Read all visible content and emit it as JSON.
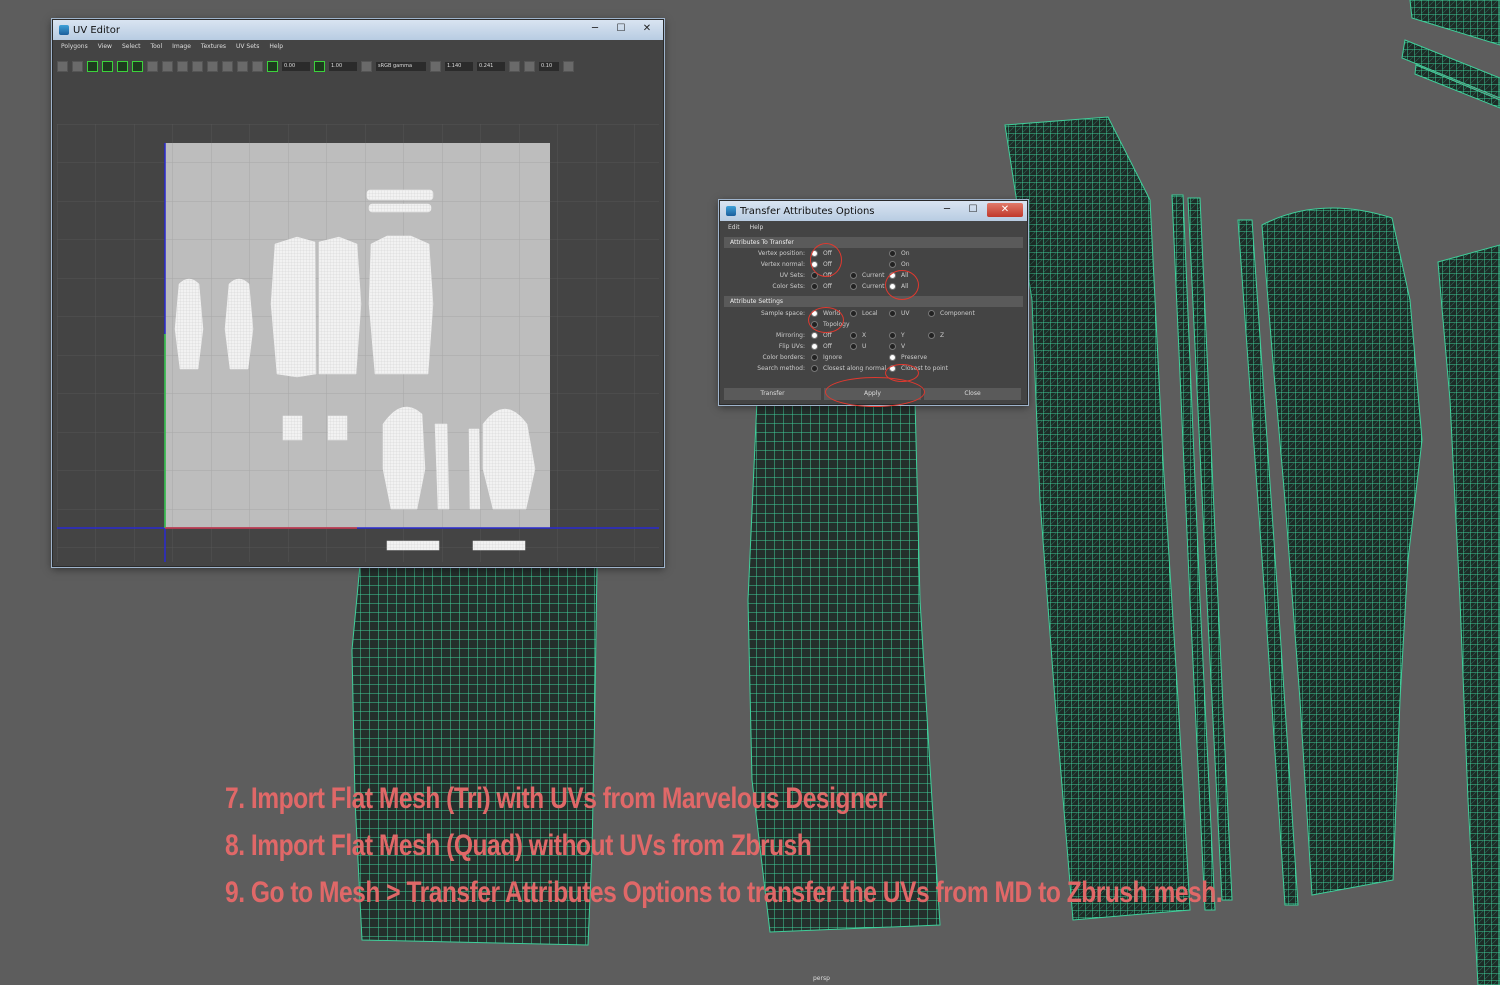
{
  "uv_editor": {
    "title": "UV Editor",
    "menu": [
      "Polygons",
      "View",
      "Select",
      "Tool",
      "Image",
      "Textures",
      "UV Sets",
      "Help"
    ],
    "fields": [
      "0.00",
      "1.00",
      "1.140",
      "0.241",
      "0.10"
    ],
    "color_space": "sRGB gamma"
  },
  "transfer_dialog": {
    "title": "Transfer Attributes Options",
    "menu": [
      "Edit",
      "Help"
    ],
    "section_attributes": "Attributes To Transfer",
    "section_settings": "Attribute Settings",
    "rows": {
      "vertex_position": {
        "label": "Vertex position:",
        "opts": [
          "Off",
          "On"
        ],
        "selected": "Off"
      },
      "vertex_normal": {
        "label": "Vertex normal:",
        "opts": [
          "Off",
          "On"
        ],
        "selected": "Off"
      },
      "uv_sets": {
        "label": "UV Sets:",
        "opts": [
          "Off",
          "Current",
          "All"
        ],
        "selected": "All"
      },
      "color_sets": {
        "label": "Color Sets:",
        "opts": [
          "Off",
          "Current",
          "All"
        ],
        "selected": "All"
      },
      "sample_space": {
        "label": "Sample space:",
        "opts": [
          "World",
          "Local",
          "UV",
          "Component",
          "Topology"
        ],
        "selected": "World"
      },
      "mirroring": {
        "label": "Mirroring:",
        "opts": [
          "Off",
          "X",
          "Y",
          "Z"
        ],
        "selected": "Off"
      },
      "flip_uvs": {
        "label": "Flip UVs:",
        "opts": [
          "Off",
          "U",
          "V"
        ],
        "selected": "Off"
      },
      "color_borders": {
        "label": "Color borders:",
        "opts": [
          "Ignore",
          "Preserve"
        ],
        "selected": "Preserve"
      },
      "search_method": {
        "label": "Search method:",
        "opts": [
          "Closest along normal",
          "Closest to point"
        ],
        "selected": "Closest to point"
      }
    },
    "buttons": {
      "transfer": "Transfer",
      "apply": "Apply",
      "close": "Close"
    }
  },
  "caption": {
    "line1": "7. Import Flat Mesh (Tri) with UVs from Marvelous Designer",
    "line2": "8. Import Flat Mesh (Quad) without UVs from Zbrush",
    "line3": "9. Go to Mesh > Transfer Attributes Options to transfer the UVs from MD to Zbrush mesh."
  },
  "viewport_label": "persp",
  "colors": {
    "wire": "#3fcf9a",
    "background": "#5d5d5d",
    "caption": "#e06868",
    "highlight": "#e0392f"
  }
}
